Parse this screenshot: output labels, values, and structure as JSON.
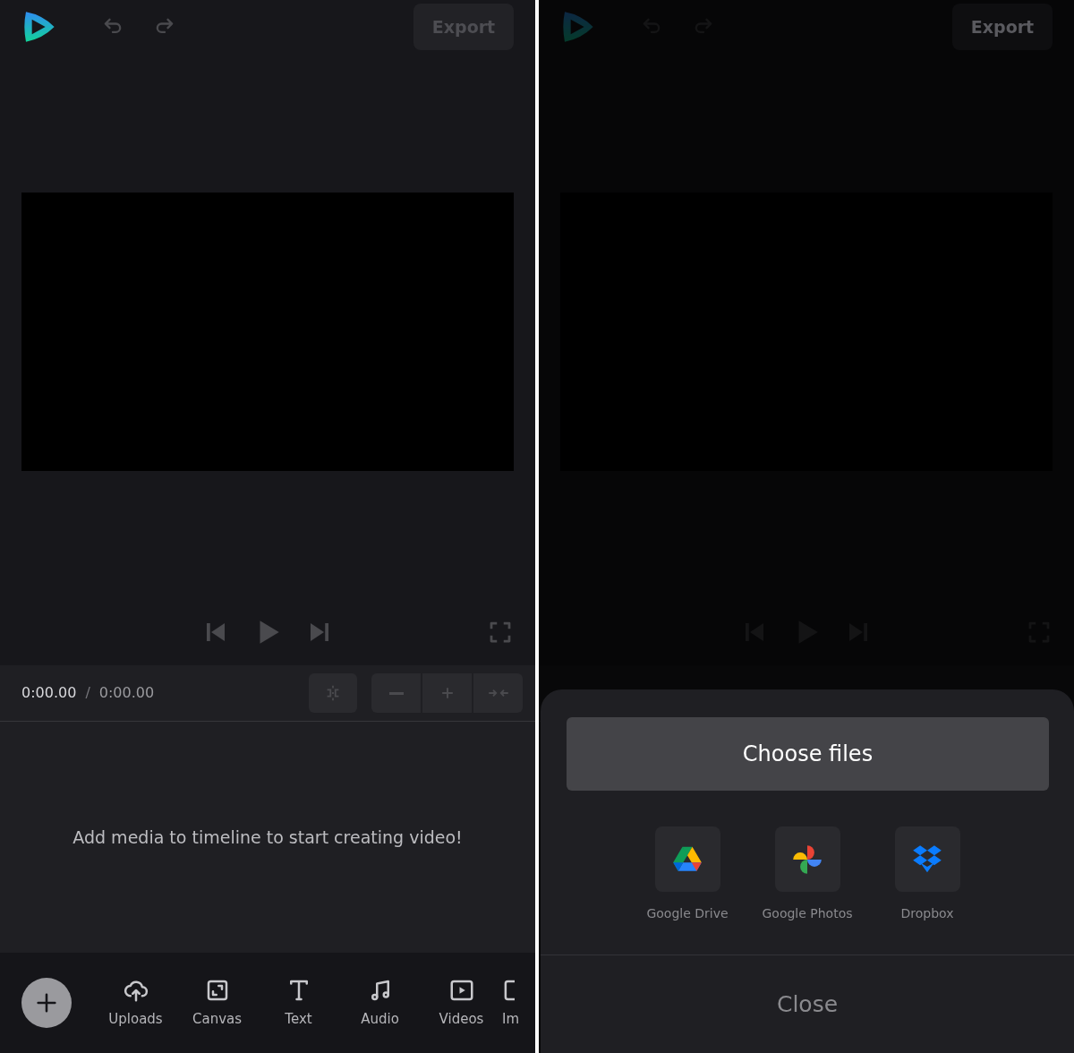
{
  "editor": {
    "header": {
      "export": "Export"
    },
    "time": {
      "current": "0:00.00",
      "separator": "/",
      "total": "0:00.00"
    },
    "empty_message": "Add media to timeline to start creating video!",
    "nav": [
      {
        "label": "Uploads",
        "kind": "uploads"
      },
      {
        "label": "Canvas",
        "kind": "canvas"
      },
      {
        "label": "Text",
        "kind": "text"
      },
      {
        "label": "Audio",
        "kind": "audio"
      },
      {
        "label": "Videos",
        "kind": "videos"
      },
      {
        "label": "Im",
        "kind": "images"
      }
    ]
  },
  "dimmed_editor": {
    "header": {
      "export": "Export"
    }
  },
  "sheet": {
    "primary": "Choose files",
    "sources": [
      {
        "label": "Google Drive",
        "kind": "drive"
      },
      {
        "label": "Google Photos",
        "kind": "photos"
      },
      {
        "label": "Dropbox",
        "kind": "dropbox"
      }
    ],
    "close": "Close"
  }
}
